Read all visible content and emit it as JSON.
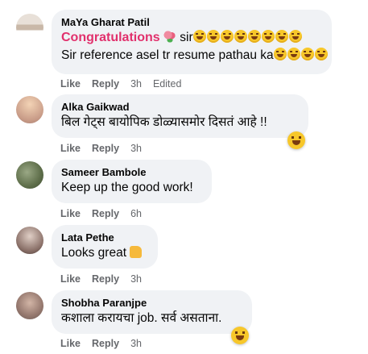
{
  "actions": {
    "like": "Like",
    "reply": "Reply"
  },
  "comments": [
    {
      "author": "MaYa Gharat Patil",
      "congrats": "Congratulations",
      "after_flower": " sir",
      "line2": "Sir reference asel tr resume pathau ka",
      "time": "3h",
      "edited": "Edited"
    },
    {
      "author": "Alka Gaikwad",
      "text": "बिल गेट्स बायोपिक डोळ्यासमोर दिसतं आहे !!",
      "time": "3h"
    },
    {
      "author": "Sameer Bambole",
      "text": "Keep up the good work!",
      "time": "6h"
    },
    {
      "author": "Lata Pethe",
      "text": "Looks great ",
      "time": "3h"
    },
    {
      "author": "Shobha Paranjpe",
      "text": "कशाला करायचा job. सर्व असताना.",
      "time": "3h"
    }
  ]
}
